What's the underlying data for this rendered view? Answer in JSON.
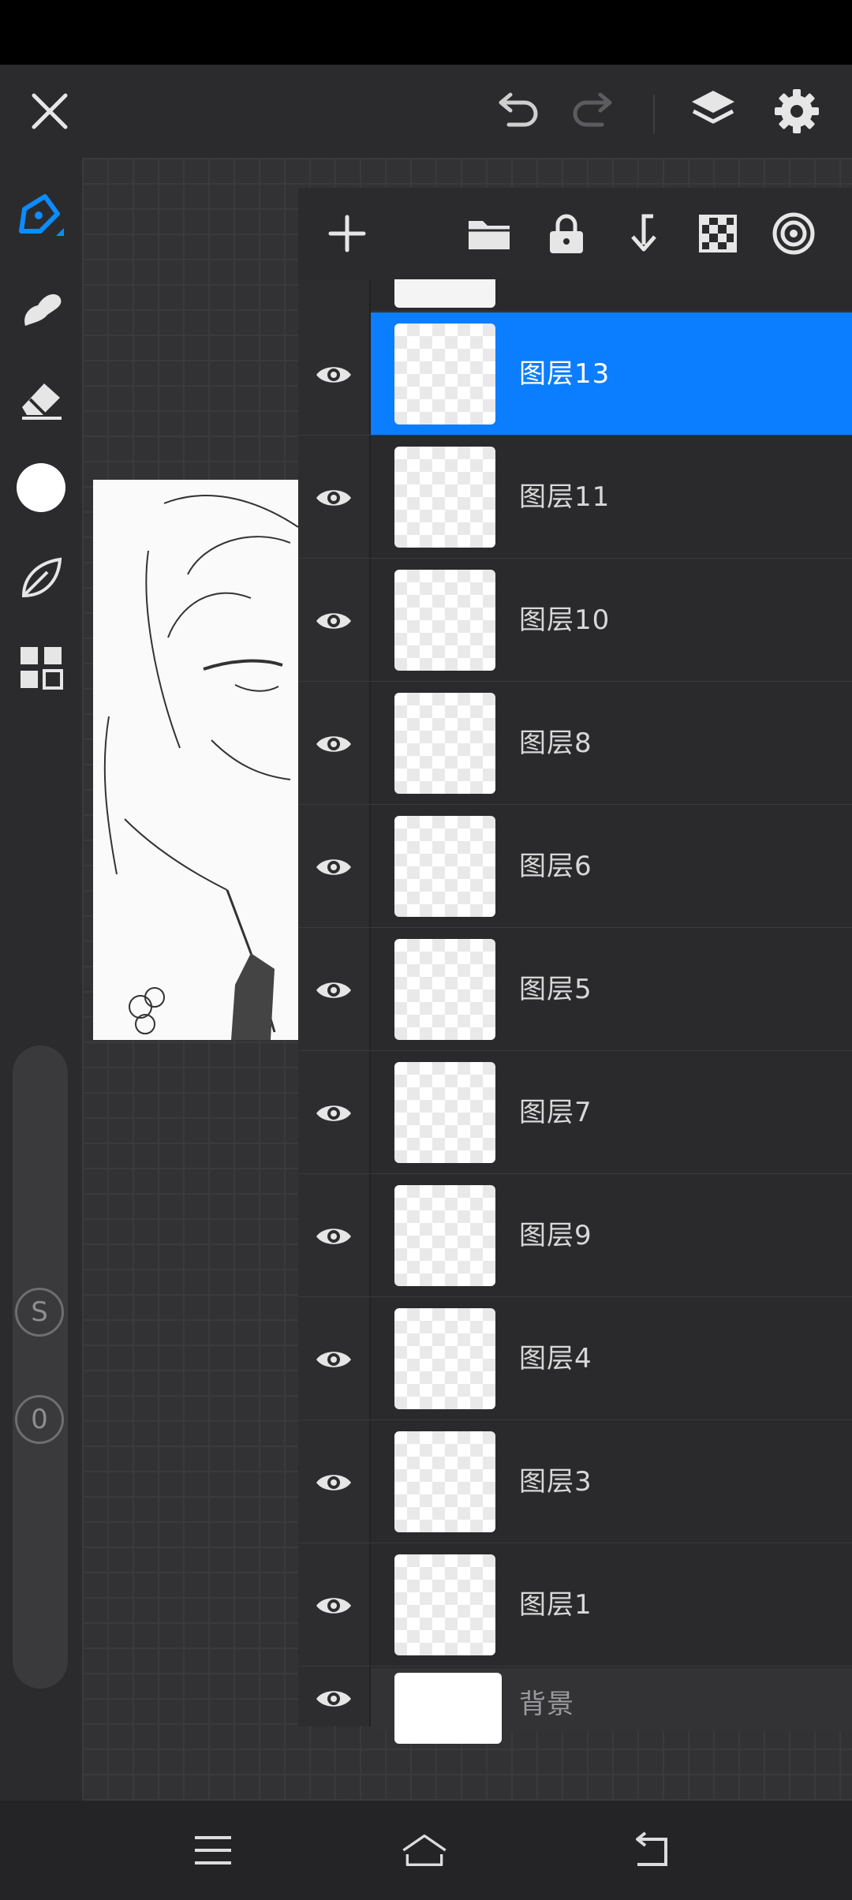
{
  "app": {
    "accent_color": "#0b7dff",
    "top_icons": [
      "close-icon",
      "undo-icon",
      "redo-icon",
      "layers-icon",
      "settings-icon"
    ]
  },
  "toolbar": {
    "tools": [
      "brush-icon",
      "smudge-icon",
      "eraser-icon",
      "color-swatch",
      "leaf-icon",
      "gallery-icon"
    ],
    "size_slider_label": "S",
    "opacity_slider_label": "0"
  },
  "layers_panel": {
    "actions": [
      "add-icon",
      "folder-icon",
      "lock-icon",
      "merge-down-icon",
      "transparency-icon",
      "target-icon"
    ],
    "layers": [
      {
        "name": "图层13",
        "selected": true
      },
      {
        "name": "图层11"
      },
      {
        "name": "图层10"
      },
      {
        "name": "图层8"
      },
      {
        "name": "图层6"
      },
      {
        "name": "图层5"
      },
      {
        "name": "图层7"
      },
      {
        "name": "图层9"
      },
      {
        "name": "图层4"
      },
      {
        "name": "图层3"
      },
      {
        "name": "图层1"
      }
    ],
    "background_label": "背景"
  },
  "navbar": {
    "icons": [
      "menu-icon",
      "home-icon",
      "back-icon"
    ]
  }
}
